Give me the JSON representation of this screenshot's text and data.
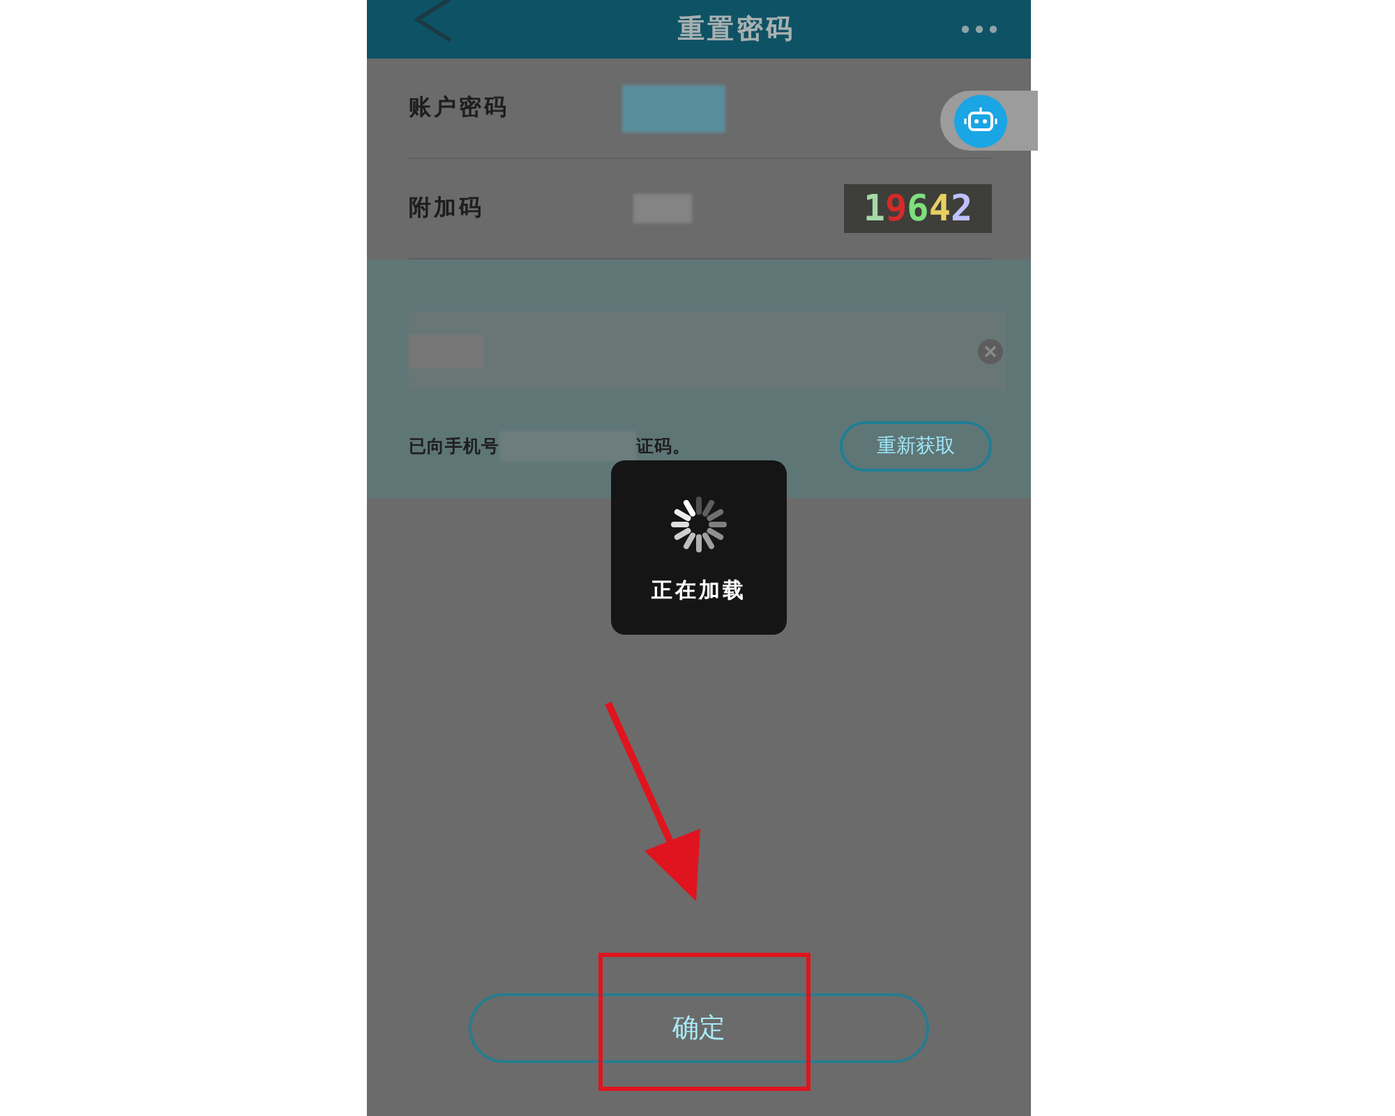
{
  "header": {
    "title": "重置密码"
  },
  "rows": [
    {
      "kind": "password",
      "label": "账户密码"
    },
    {
      "kind": "captcha",
      "label": "附加码",
      "captcha": [
        {
          "text": "1",
          "color": "#a6d8a6"
        },
        {
          "text": "9",
          "color": "#d42a2a"
        },
        {
          "text": "6",
          "color": "#7ee07e"
        },
        {
          "text": "4",
          "color": "#e8d060"
        },
        {
          "text": "2",
          "color": "#c0c0ff"
        }
      ]
    }
  ],
  "verification": {
    "message_start": "已向手机号",
    "message_end": "证码。",
    "resend_button": "重新获取"
  },
  "loading": {
    "text": "正在加载"
  },
  "confirm_button": "确定",
  "annotation": {
    "arrow": true,
    "highlight_box": true
  }
}
